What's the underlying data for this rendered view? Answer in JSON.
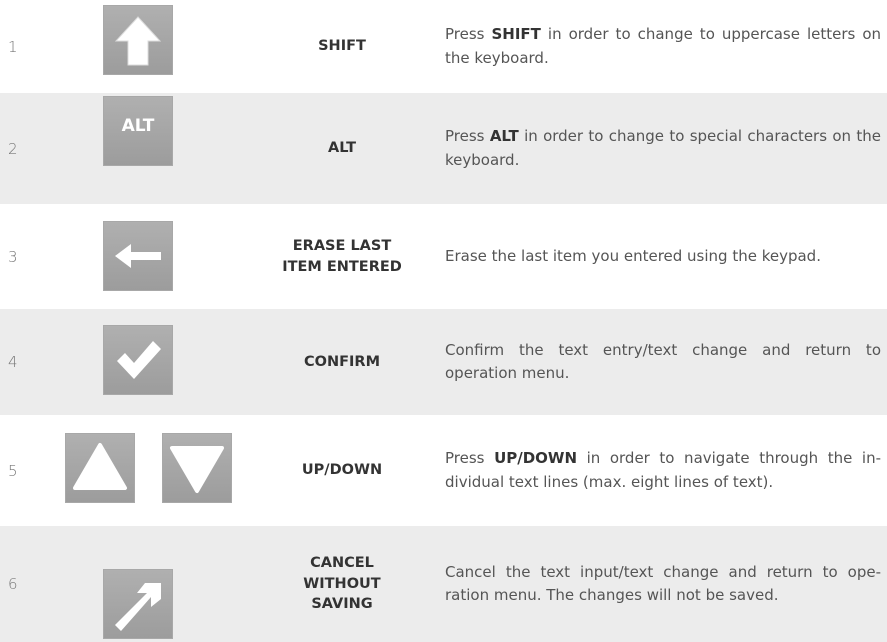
{
  "rows": [
    {
      "num": "1",
      "name": "SHIFT",
      "icon": "up-arrow-icon",
      "desc_pre": "Press ",
      "desc_bold": "SHIFT",
      "desc_post": " in order to change to uppercase letters on the keyboard."
    },
    {
      "num": "2",
      "name": "ALT",
      "icon": "alt-key-icon",
      "icon_text": "ALT",
      "desc_pre": "Press ",
      "desc_bold": "ALT",
      "desc_post": " in order to change to special characters on the keyboard."
    },
    {
      "num": "3",
      "name_line1": "ERASE LAST",
      "name_line2": "ITEM ENTERED",
      "icon": "left-arrow-icon",
      "desc": "Erase the last item you entered using the keypad."
    },
    {
      "num": "4",
      "name": "CONFIRM",
      "icon": "checkmark-icon",
      "desc": "Confirm the text entry/text change and return to operation menu."
    },
    {
      "num": "5",
      "name": "UP/DOWN",
      "icon": "up-triangle-icon",
      "icon2": "down-triangle-icon",
      "desc_pre": "Press ",
      "desc_bold": "UP/DOWN",
      "desc_post": " in order to navigate through the in-dividual text lines (max. eight lines of text)."
    },
    {
      "num": "6",
      "name_line1": "CANCEL",
      "name_line2": "WITHOUT",
      "name_line3": "SAVING",
      "icon": "diagonal-arrow-icon",
      "desc": "Cancel the text input/text change and return to ope-ration menu. The changes will not be saved."
    }
  ],
  "colors": {
    "row_shade": "#ececec",
    "icon_bg": "#a6a6a6",
    "icon_fg": "#ffffff"
  }
}
